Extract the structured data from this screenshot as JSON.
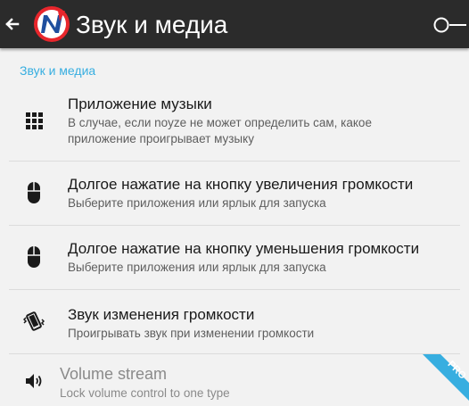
{
  "appbar": {
    "title": "Звук и медиа",
    "back_icon": "arrow-back-icon",
    "logo_icon": "noyze-logo-icon",
    "toggle_icon": "switch-toggle-icon"
  },
  "section": {
    "header": "Звук и медиа"
  },
  "items": [
    {
      "title": "Приложение музыки",
      "subtitle": "В случае, если noyze не может определить сам, какое приложение проигрывает музыку",
      "icon": "apps-grid-icon"
    },
    {
      "title": "Долгое нажатие на кнопку увеличения громкости",
      "subtitle": "Выберите приложения или ярлык для запуска",
      "icon": "mouse-icon"
    },
    {
      "title": "Долгое нажатие на кнопку уменьшения громкости",
      "subtitle": "Выберите приложения или ярлык для запуска",
      "icon": "mouse-icon"
    },
    {
      "title": "Звук изменения громкости",
      "subtitle": "Проигрывать звук при изменении громкости",
      "icon": "vibrate-icon"
    },
    {
      "title": "Volume stream",
      "subtitle": "Lock volume control to one type",
      "icon": "speaker-icon",
      "badge": "PRO"
    }
  ],
  "colors": {
    "appbar": "#2b2b2b",
    "accent": "#37aee0",
    "background": "#f2f2f2",
    "logo_red": "#e8262c",
    "logo_blue": "#1f4f9e"
  }
}
